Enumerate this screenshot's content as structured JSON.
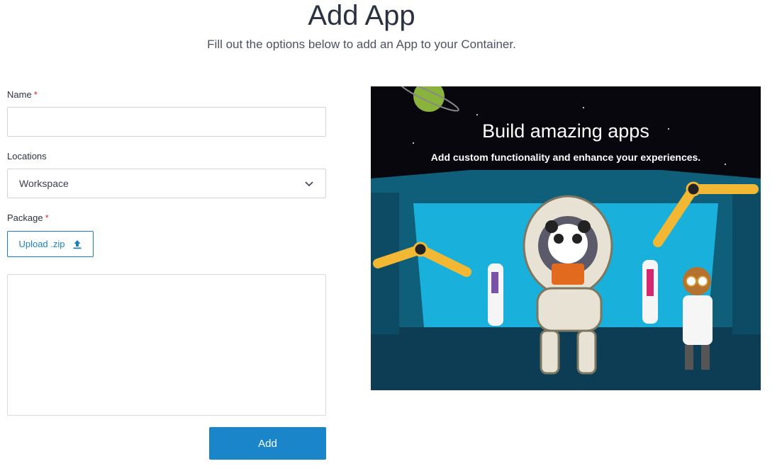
{
  "header": {
    "title": "Add App",
    "subtitle": "Fill out the options below to add an App to your Container."
  },
  "form": {
    "name": {
      "label": "Name",
      "required_mark": "*",
      "value": ""
    },
    "locations": {
      "label": "Locations",
      "selected": "Workspace"
    },
    "package": {
      "label": "Package",
      "required_mark": "*",
      "upload_label": "Upload .zip"
    },
    "submit_label": "Add"
  },
  "hero": {
    "title": "Build amazing apps",
    "subtitle": "Add custom functionality and enhance your experiences."
  },
  "icons": {
    "select": "chevron-down-icon",
    "upload": "upload-icon"
  },
  "colors": {
    "primary": "#1a86c9",
    "required": "#d92b2b",
    "hero_bg": "#0a0a12"
  }
}
